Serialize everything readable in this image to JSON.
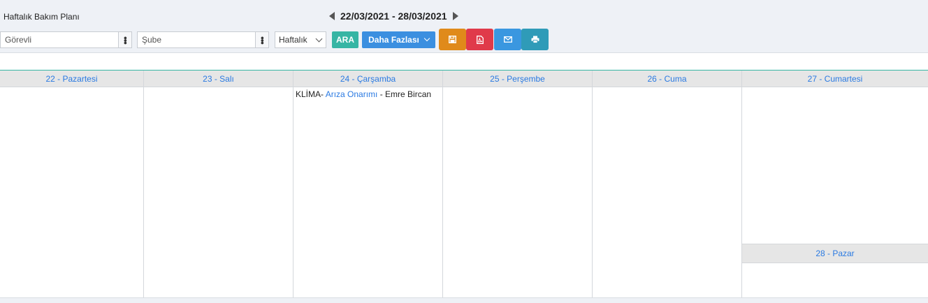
{
  "header": {
    "title": "Haftalık Bakım Planı",
    "date_range": "22/03/2021 - 28/03/2021"
  },
  "filters": {
    "assignee_placeholder": "Görevli",
    "branch_placeholder": "Şube",
    "period_value": "Haftalık",
    "search_label": "ARA",
    "more_label": "Daha Fazlası"
  },
  "colors": {
    "accent_teal": "#36b5a4",
    "accent_blue": "#3b8fe0",
    "save_orange": "#e08a1a",
    "pdf_red": "#e03a4a",
    "mail_blue": "#3a97e0",
    "print_teal": "#2f9bb8"
  },
  "icons": {
    "save": "floppy-disk-icon",
    "pdf": "pdf-file-icon",
    "mail": "envelope-icon",
    "print": "printer-icon"
  },
  "calendar": {
    "days": [
      {
        "label": "22 - Pazartesi"
      },
      {
        "label": "23 - Salı"
      },
      {
        "label": "24 - Çarşamba"
      },
      {
        "label": "25 - Perşembe"
      },
      {
        "label": "26 - Cuma"
      },
      {
        "label": "27 - Cumartesi"
      },
      {
        "label": "28 - Pazar"
      }
    ],
    "event": {
      "prefix": "KLİMA-",
      "task": "Arıza Onarımı",
      "suffix": " - Emre Bircan"
    }
  }
}
